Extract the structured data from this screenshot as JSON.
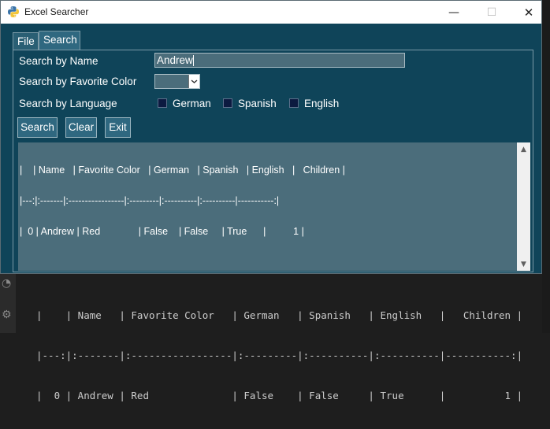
{
  "window": {
    "title": "Excel Searcher",
    "controls": {
      "minimize": "—",
      "maximize": "☐",
      "close": "✕"
    }
  },
  "tabs": [
    {
      "label": "File",
      "active": false
    },
    {
      "label": "Search",
      "active": true
    }
  ],
  "form": {
    "name_label": "Search by Name",
    "name_value": "Andrew",
    "color_label": "Search by Favorite Color",
    "color_value": "",
    "language_label": "Search by Language",
    "languages": [
      {
        "label": "German",
        "checked": false
      },
      {
        "label": "Spanish",
        "checked": false
      },
      {
        "label": "English",
        "checked": false
      }
    ]
  },
  "buttons": {
    "search": "Search",
    "clear": "Clear",
    "exit": "Exit"
  },
  "output": {
    "lines": [
      "|    | Name   | Favorite Color   | German   | Spanish   | English   |   Children |",
      "|---:|:-------|:-----------------|:---------|:----------|:----------|-----------:|",
      "|  0 | Andrew | Red              | False    | False     | True      |          1 |"
    ]
  },
  "terminal": {
    "lines": [
      "|    | Name   | Favorite Color   | German   | Spanish   | English   |   Children |",
      "|---:|:-------|:-----------------|:---------|:----------|:----------|-----------:|",
      "|  0 | Andrew | Red              | False    | False     | True      |          1 |"
    ]
  },
  "colors": {
    "window_bg": "#0f4459",
    "field_bg": "#4b6d7b",
    "button_bg": "#2f6880",
    "checkbox_bg": "#0c1a40"
  }
}
